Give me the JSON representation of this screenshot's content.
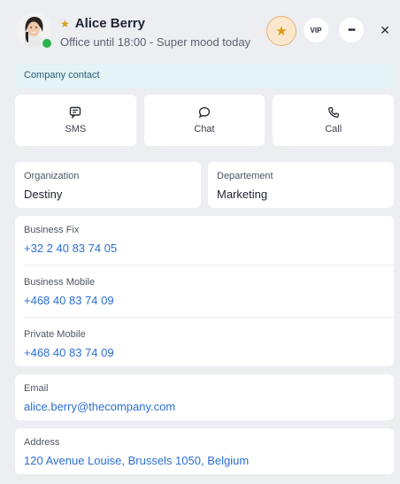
{
  "contact": {
    "name": "Alice Berry",
    "status": "Office until 18:00 - Super mood today",
    "presence_color": "#2bb24c"
  },
  "header_buttons": {
    "vip_label": "VIP",
    "more_label": "•••",
    "close_label": "✕"
  },
  "banner": {
    "label": "Company contact"
  },
  "actions": [
    {
      "label": "SMS",
      "icon": "sms-icon"
    },
    {
      "label": "Chat",
      "icon": "chat-icon"
    },
    {
      "label": "Call",
      "icon": "phone-icon"
    }
  ],
  "organization": {
    "label": "Organization",
    "value": "Destiny"
  },
  "department": {
    "label": "Departement",
    "value": "Marketing"
  },
  "phones": [
    {
      "label": "Business Fix",
      "value": "+32 2 40 83 74 05"
    },
    {
      "label": "Business Mobile",
      "value": "+468 40 83 74 09"
    },
    {
      "label": "Private Mobile",
      "value": "+468 40 83 74 09"
    }
  ],
  "email": {
    "label": "Email",
    "value": "alice.berry@thecompany.com"
  },
  "address": {
    "label": "Address",
    "value": "120 Avenue Louise, Brussels 1050, Belgium"
  },
  "colors": {
    "accent_link": "#2c6fd1",
    "favorite": "#d89b13",
    "banner_bg": "#e4f3f5"
  }
}
